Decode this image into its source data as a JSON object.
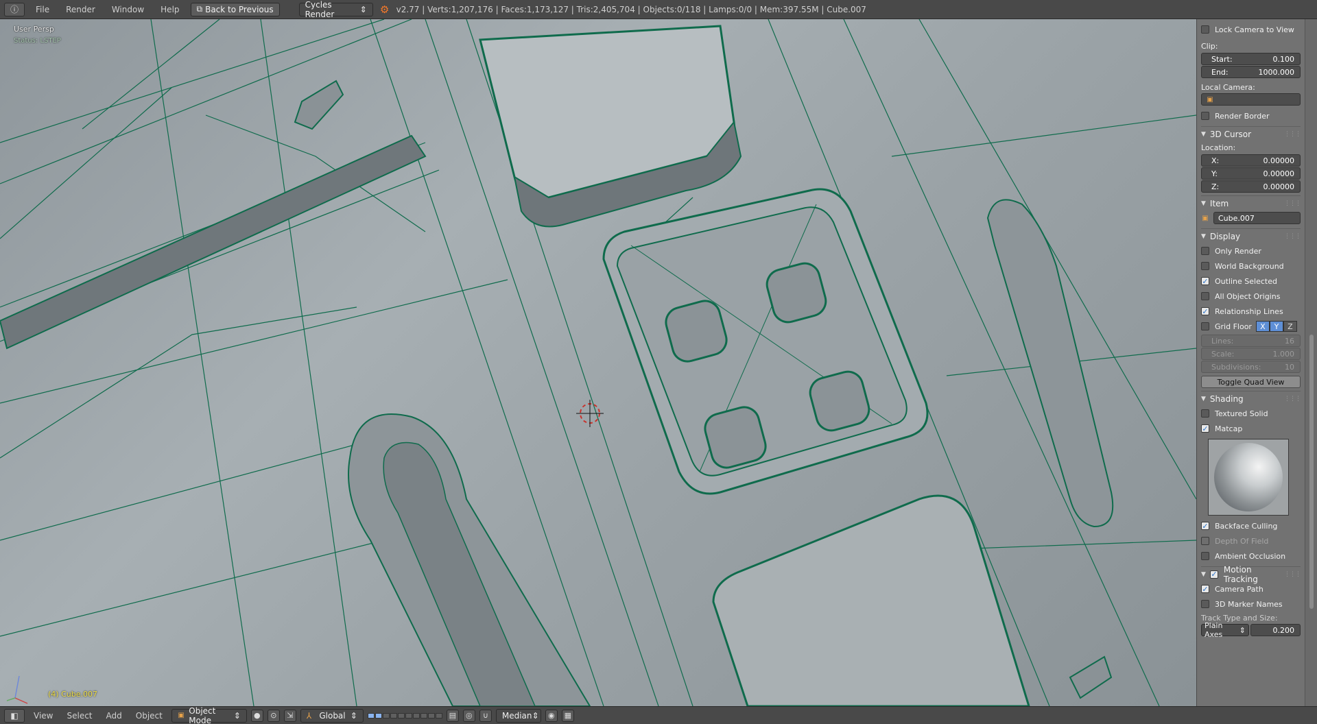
{
  "header": {
    "menus": [
      "File",
      "Render",
      "Window",
      "Help"
    ],
    "back_label": "Back to Previous",
    "render_engine": "Cycles Render",
    "stats": "v2.77 | Verts:1,207,176 | Faces:1,173,127 | Tris:2,405,704 | Objects:0/118 | Lamps:0/0 | Mem:397.55M | Cube.007"
  },
  "viewport": {
    "view_name": "User Persp",
    "status": "Status: LSTEP",
    "object_label": "(4) Cube.007",
    "colors": {
      "wire": "#0f6b4c",
      "surface": "#9ca4a8"
    }
  },
  "panel": {
    "lock_camera": {
      "label": "Lock Camera to View",
      "checked": false
    },
    "clip_label": "Clip:",
    "clip_start": {
      "label": "Start:",
      "value": "0.100"
    },
    "clip_end": {
      "label": "End:",
      "value": "1000.000"
    },
    "local_camera_label": "Local Camera:",
    "render_border": {
      "label": "Render Border",
      "checked": false
    },
    "cursor_section": "3D Cursor",
    "location_label": "Location:",
    "cursor_x": {
      "label": "X:",
      "value": "0.00000"
    },
    "cursor_y": {
      "label": "Y:",
      "value": "0.00000"
    },
    "cursor_z": {
      "label": "Z:",
      "value": "0.00000"
    },
    "item_section": "Item",
    "item_name": "Cube.007",
    "display_section": "Display",
    "only_render": {
      "label": "Only Render",
      "checked": false
    },
    "world_background": {
      "label": "World Background",
      "checked": false
    },
    "outline_selected": {
      "label": "Outline Selected",
      "checked": true
    },
    "all_object_origins": {
      "label": "All Object Origins",
      "checked": false
    },
    "relationship_lines": {
      "label": "Relationship Lines",
      "checked": true
    },
    "grid_floor": {
      "label": "Grid Floor",
      "checked": false
    },
    "axes": [
      "X",
      "Y",
      "Z"
    ],
    "lines": {
      "label": "Lines:",
      "value": "16"
    },
    "scale": {
      "label": "Scale:",
      "value": "1.000"
    },
    "subdivisions": {
      "label": "Subdivisions:",
      "value": "10"
    },
    "toggle_quad_view": "Toggle Quad View",
    "shading_section": "Shading",
    "textured_solid": {
      "label": "Textured Solid",
      "checked": false
    },
    "matcap": {
      "label": "Matcap",
      "checked": true
    },
    "backface_culling": {
      "label": "Backface Culling",
      "checked": true
    },
    "depth_of_field": {
      "label": "Depth Of Field",
      "checked": false
    },
    "ambient_occlusion": {
      "label": "Ambient Occlusion",
      "checked": false
    },
    "motion_tracking_section": "Motion Tracking",
    "camera_path": {
      "label": "Camera Path",
      "checked": true
    },
    "marker_names": {
      "label": "3D Marker Names",
      "checked": false
    },
    "track_type_label": "Track Type and Size:",
    "track_type": "Plain Axes",
    "track_size": "0.200"
  },
  "footer": {
    "menus": [
      "View",
      "Select",
      "Add",
      "Object"
    ],
    "mode": "Object Mode",
    "orientation": "Global",
    "pivot": "Median"
  }
}
